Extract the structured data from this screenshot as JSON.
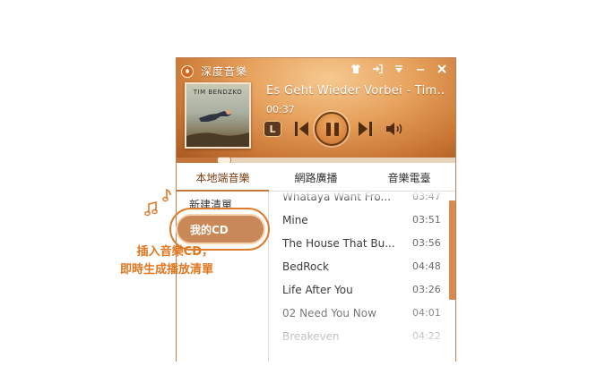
{
  "app": {
    "title": "深度音樂"
  },
  "now_playing": {
    "title": "Es Geht Wieder Vorbei - Tim...",
    "time": "00:37",
    "album_artist_text": "TIM BENDZKO",
    "progress": 0.15
  },
  "controls": {
    "lyric_label": "L"
  },
  "tabs": [
    {
      "label": "本地端音樂",
      "active": true
    },
    {
      "label": "網路廣播",
      "active": false
    },
    {
      "label": "音樂電臺",
      "active": false
    }
  ],
  "sidebar": {
    "items": [
      {
        "label": "新建清單"
      },
      {
        "label": "我的CD"
      }
    ]
  },
  "tracks": [
    {
      "name": "Whataya Want Fro...",
      "duration": "03:47"
    },
    {
      "name": "Mine",
      "duration": "03:51"
    },
    {
      "name": "The House That Bu...",
      "duration": "03:56"
    },
    {
      "name": "BedRock",
      "duration": "04:48"
    },
    {
      "name": "Life After You",
      "duration": "03:26"
    },
    {
      "name": "02 Need You Now",
      "duration": "04:01"
    },
    {
      "name": "Breakeven",
      "duration": "04:22"
    }
  ],
  "callout": {
    "line1": "插入音樂CD，",
    "line2": "即時生成播放清單"
  },
  "colors": {
    "accent": "#e0761f",
    "player_bg": "#d68a48",
    "scrollbar": "#d98a4c"
  },
  "icons": [
    "app-logo-icon",
    "skin-icon",
    "mini-mode-icon",
    "menu-icon",
    "minimize-icon",
    "close-icon",
    "prev-icon",
    "pause-icon",
    "next-icon",
    "volume-icon",
    "music-notes-icon"
  ]
}
